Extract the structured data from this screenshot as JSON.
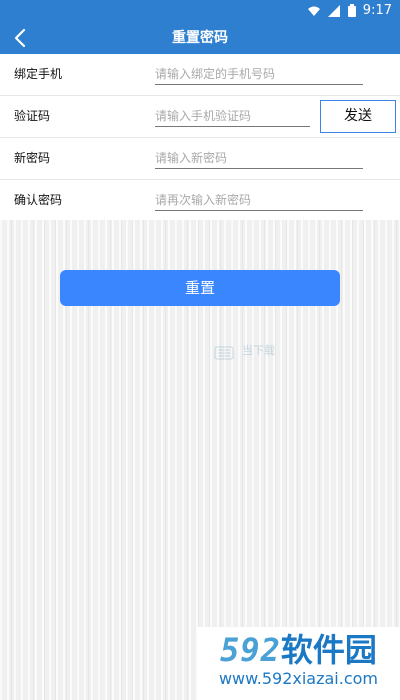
{
  "status": {
    "time": "9:17"
  },
  "appbar": {
    "title": "重置密码"
  },
  "form": {
    "rows": [
      {
        "label": "绑定手机",
        "placeholder": "请输入绑定的手机号码"
      },
      {
        "label": "验证码",
        "placeholder": "请输入手机验证码",
        "button": "发送"
      },
      {
        "label": "新密码",
        "placeholder": "请输入新密码"
      },
      {
        "label": "确认密码",
        "placeholder": "请再次输入新密码"
      }
    ]
  },
  "actions": {
    "reset_label": "重置"
  },
  "watermark": {
    "site": "592软件园",
    "url": "www.592xiazai.com",
    "text": "当下载"
  },
  "colors": {
    "primary": "#2f7fd0",
    "button": "#3a86ff",
    "brand_light": "#49a1d6",
    "brand_dark": "#1b78c4"
  }
}
